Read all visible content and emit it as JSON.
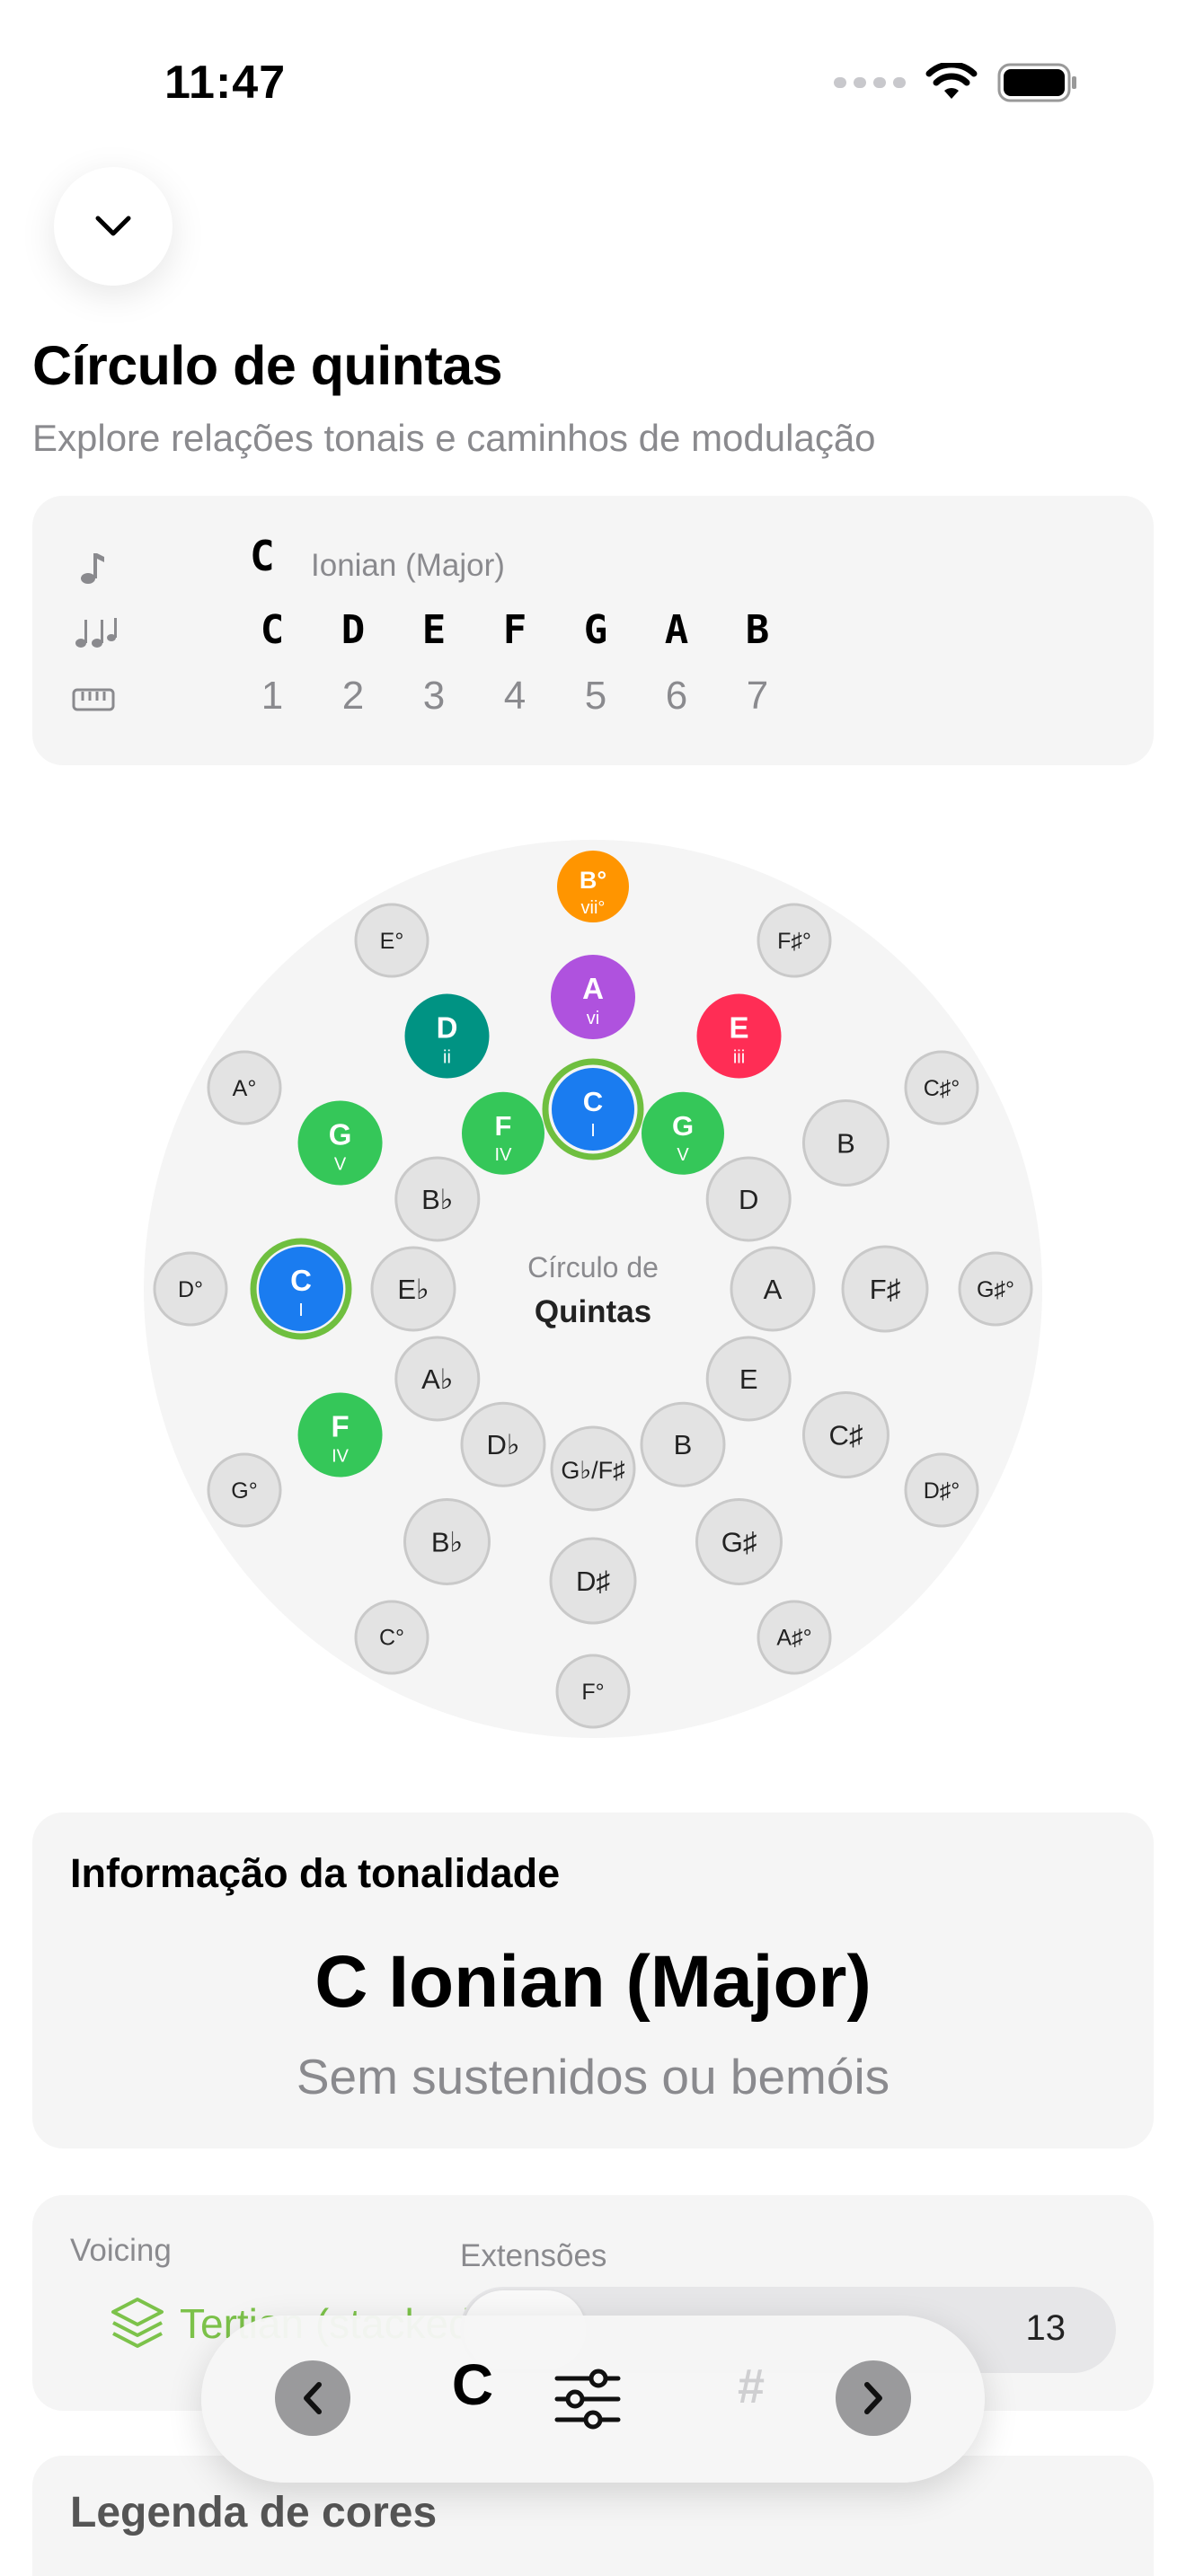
{
  "status": {
    "time": "11:47"
  },
  "header": {
    "title": "Círculo de quintas",
    "subtitle": "Explore relações tonais e caminhos de modulação"
  },
  "scale": {
    "root": "C",
    "mode": "Ionian (Major)",
    "notes": [
      "C",
      "D",
      "E",
      "F",
      "G",
      "A",
      "B"
    ],
    "degrees": [
      "1",
      "2",
      "3",
      "4",
      "5",
      "6",
      "7"
    ],
    "icons": [
      "note-icon",
      "notes-icon",
      "piano-icon"
    ]
  },
  "circle": {
    "center_line1": "Círculo de",
    "center_line2": "Quintas",
    "outer_ring": [
      "B°",
      "F#°",
      "C#°",
      "G#°",
      "D#°",
      "A#°",
      "F°",
      "C°",
      "G°",
      "D°",
      "A°",
      "E°"
    ],
    "middle_ring": [
      "A",
      "E",
      "B",
      "F#",
      "C#",
      "G#",
      "D#",
      "Bb",
      "F",
      "C",
      "G",
      "D"
    ],
    "inner_ring": [
      "C",
      "G",
      "D",
      "A",
      "E",
      "B",
      "Gb/F#",
      "Db",
      "Ab",
      "Eb",
      "Bb",
      "F"
    ],
    "highlighted": [
      {
        "note": "C",
        "roman": "I",
        "color": "#1a7cf0"
      },
      {
        "note": "G",
        "roman": "V",
        "color": "#35c759"
      },
      {
        "note": "F",
        "roman": "IV",
        "color": "#35c759"
      },
      {
        "note": "D",
        "roman": "ii",
        "color": "#009383"
      },
      {
        "note": "A",
        "roman": "vi",
        "color": "#af52de"
      },
      {
        "note": "E",
        "roman": "iii",
        "color": "#ff2d55"
      },
      {
        "note": "B°",
        "roman": "vii°",
        "color": "#ff9500"
      }
    ]
  },
  "key_info": {
    "heading": "Informação da tonalidade",
    "key_name": "C Ionian (Major)",
    "accidentals": "Sem sustenidos ou bemóis"
  },
  "voicing": {
    "label": "Voicing",
    "value": "Tertian (stacked)",
    "extensions_label": "Extensões",
    "extensions_value": "13"
  },
  "legend": {
    "title": "Legenda de cores"
  },
  "toolbar": {
    "key": "C",
    "sharp": "#"
  },
  "colors": {
    "accent_green": "#7cc24a",
    "card_bg": "#f5f5f5",
    "muted": "#8a8a8e"
  }
}
